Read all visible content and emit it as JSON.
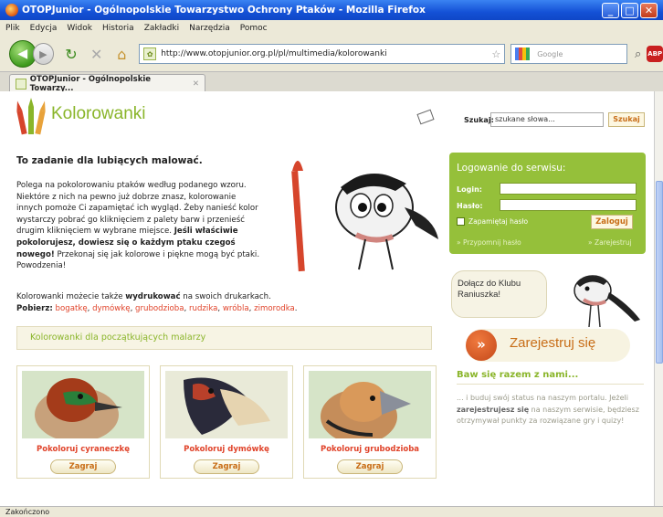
{
  "window": {
    "title": "OTOPJunior - Ogólnopolskie Towarzystwo Ochrony Ptaków - Mozilla Firefox",
    "minimize": "_",
    "maximize": "□",
    "close": "✕"
  },
  "menu": [
    "Plik",
    "Edycja",
    "Widok",
    "Historia",
    "Zakładki",
    "Narzędzia",
    "Pomoc"
  ],
  "nav": {
    "url": "http://www.otopjunior.org.pl/pl/multimedia/kolorowanki",
    "search_placeholder": "Google",
    "adblock": "ABP"
  },
  "tab": {
    "label": "OTOPJunior - Ogólnopolskie Towarzy...",
    "close": "✕"
  },
  "status": "Zakończono",
  "page": {
    "title": "Kolorowanki",
    "search_label": "Szukaj:",
    "search_value": "szukane słowa...",
    "search_button": "Szukaj",
    "heading": "To zadanie dla lubiących malować.",
    "intro_1": "Polega na pokolorowaniu ptaków według podanego wzoru. Niektóre z nich na pewno już dobrze znasz, kolorowanie innych pomoże Ci zapamiętać ich wygląd. Żeby nanieść kolor wystarczy pobrać go kliknięciem z palety barw i przenieść drugim kliknięciem w wybrane miejsce. ",
    "intro_bold": "Jeśli właściwie pokolorujesz, dowiesz się o każdym ptaku czegoś nowego!",
    "intro_2": " Przekonaj się jak kolorowe i piękne mogą być ptaki. Powodzenia!",
    "print_1": "Kolorowanki możecie także ",
    "print_bold": "wydrukować",
    "print_2": " na swoich drukarkach.",
    "download_label": "Pobierz:",
    "downloads": [
      "bogatkę",
      "dymówkę",
      "grubodzioba",
      "rudzika",
      "wróbla",
      "zimorodka"
    ],
    "section_title": "Kolorowanki dla początkujących malarzy",
    "cards": [
      {
        "label": "Pokoloruj cyraneczkę",
        "button": "Zagraj"
      },
      {
        "label": "Pokoloruj dymówkę",
        "button": "Zagraj"
      },
      {
        "label": "Pokoloruj grubodzioba",
        "button": "Zagraj"
      }
    ]
  },
  "sidebar": {
    "login_title": "Logowanie do serwisu:",
    "login_label": "Login:",
    "password_label": "Hasło:",
    "remember": "Zapamiętaj hasło",
    "login_button": "Zaloguj",
    "forgot": "» Przypomnij hasło",
    "register_link": "» Zarejestruj",
    "club_text": "Dołącz do Klubu Raniuszka!",
    "register_button": "Zarejestruj się",
    "play_heading": "Baw się razem z nami...",
    "play_1": "... i buduj swój status na naszym portalu. Jeżeli ",
    "play_bold": "zarejestrujesz się",
    "play_2": " na naszym serwisie, będziesz otrzymywał punkty za rozwiązane gry i quizy!"
  },
  "colors": {
    "accent_green": "#95c03a",
    "link_red": "#e0432a",
    "button_orange": "#c86d17"
  }
}
